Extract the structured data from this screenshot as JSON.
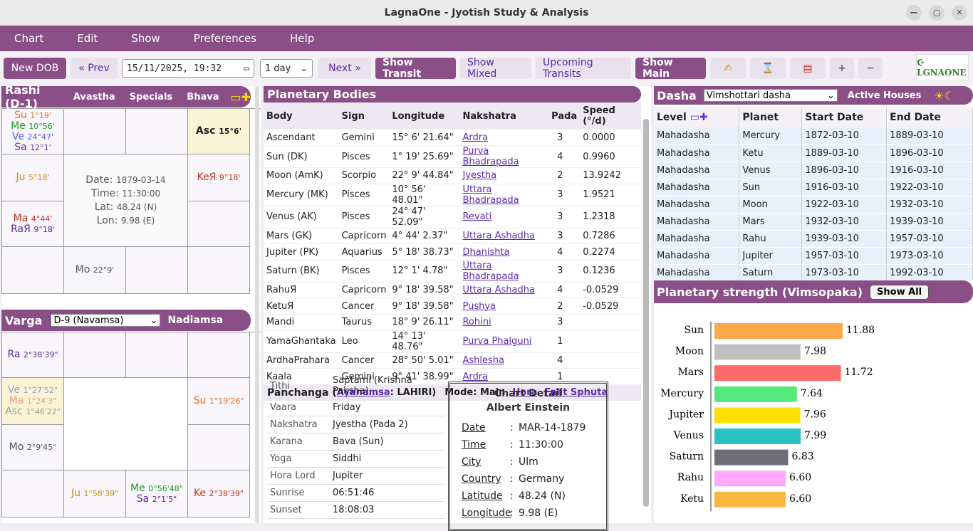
{
  "window": {
    "title": "LagnaOne - Jyotish Study & Analysis"
  },
  "menu": [
    "Chart",
    "Edit",
    "Show",
    "Preferences",
    "Help"
  ],
  "toolbar": {
    "new_dob": "New DOB",
    "prev": "« Prev",
    "datetime": "15/11/2025, 19:32",
    "step": "1 day",
    "next": "Next »",
    "show_transit": "Show Transit",
    "show_mixed": "Show Mixed",
    "upcoming": "Upcoming Transits",
    "show_main": "Show Main",
    "plus": "+",
    "minus": "−"
  },
  "icons": [
    "pen-icon",
    "hourglass-icon",
    "books-icon",
    "plus-icon",
    "minus-icon",
    "calendar-icon",
    "sun-moon-icon"
  ],
  "rashi": {
    "title": "Rashi (D-1)",
    "tabs": [
      "Avastha",
      "Specials",
      "Bhava"
    ],
    "center": {
      "date_label": "Date:",
      "date": "1879-03-14",
      "time_label": "Time:",
      "time": "11:30:00",
      "lat_label": "Lat:",
      "lat": "48.24 (N)",
      "lon_label": "Lon:",
      "lon": "9.98 (E)"
    },
    "cells": [
      {
        "r": 1,
        "c": 1,
        "items": [
          {
            "p": "Su",
            "d": "1°19'",
            "col": "#e07020"
          },
          {
            "p": "Me",
            "d": "10°56'",
            "col": "#1a9a1a"
          },
          {
            "p": "Ve",
            "d": "24°47'",
            "col": "#5a5ad8"
          },
          {
            "p": "Sa",
            "d": "12°1'",
            "col": "#6a2a8a"
          }
        ]
      },
      {
        "r": 1,
        "c": 2,
        "items": []
      },
      {
        "r": 1,
        "c": 3,
        "items": []
      },
      {
        "r": 1,
        "c": 4,
        "items": [
          {
            "p": "Asc",
            "d": "15°6'",
            "col": "#222"
          }
        ],
        "asc": true
      },
      {
        "r": 2,
        "c": 1,
        "items": [
          {
            "p": "Ju",
            "d": "5°18'",
            "col": "#d08a10"
          }
        ]
      },
      {
        "r": 2,
        "c": 4,
        "items": [
          {
            "p": "KeЯ",
            "d": "9°18'",
            "col": "#c03020"
          }
        ]
      },
      {
        "r": 3,
        "c": 1,
        "items": [
          {
            "p": "Ma",
            "d": "4°44'",
            "col": "#c03020"
          },
          {
            "p": "RaЯ",
            "d": "9°18'",
            "col": "#5a2a9a"
          }
        ]
      },
      {
        "r": 3,
        "c": 4,
        "items": []
      },
      {
        "r": 4,
        "c": 1,
        "items": []
      },
      {
        "r": 4,
        "c": 2,
        "items": [
          {
            "p": "Mo",
            "d": "22°9'",
            "col": "#555"
          }
        ]
      },
      {
        "r": 4,
        "c": 3,
        "items": []
      },
      {
        "r": 4,
        "c": 4,
        "items": []
      }
    ]
  },
  "varga": {
    "title": "Varga",
    "select": "D-9 (Navamsa)",
    "tab": "Nadiamsa",
    "cells": [
      {
        "r": 1,
        "c": 1,
        "items": [
          {
            "p": "Ra",
            "d": "2°38'39\"",
            "col": "#5a2a9a"
          }
        ]
      },
      {
        "r": 1,
        "c": 2,
        "items": []
      },
      {
        "r": 1,
        "c": 3,
        "items": []
      },
      {
        "r": 1,
        "c": 4,
        "items": []
      },
      {
        "r": 2,
        "c": 1,
        "items": [
          {
            "p": "Ve",
            "d": "1°27'52\"",
            "col": "#9a9ae0"
          },
          {
            "p": "Ma",
            "d": "1°24'3\"",
            "col": "#e8a080"
          },
          {
            "p": "Asc",
            "d": "1°46'22\"",
            "col": "#999"
          }
        ],
        "asc": true
      },
      {
        "r": 2,
        "c": 4,
        "items": [
          {
            "p": "Su",
            "d": "1°19'26\"",
            "col": "#e07020"
          }
        ]
      },
      {
        "r": 3,
        "c": 1,
        "items": [
          {
            "p": "Mo",
            "d": "2°9'45\"",
            "col": "#555"
          }
        ]
      },
      {
        "r": 3,
        "c": 4,
        "items": []
      },
      {
        "r": 4,
        "c": 1,
        "items": []
      },
      {
        "r": 4,
        "c": 2,
        "items": [
          {
            "p": "Ju",
            "d": "1°58'39\"",
            "col": "#d08a10"
          }
        ]
      },
      {
        "r": 4,
        "c": 3,
        "items": [
          {
            "p": "Me",
            "d": "0°56'48\"",
            "col": "#1a9a1a"
          },
          {
            "p": "Sa",
            "d": "2°1'5\"",
            "col": "#6a2a8a"
          }
        ]
      },
      {
        "r": 4,
        "c": 4,
        "items": [
          {
            "p": "Ke",
            "d": "2°38'39\"",
            "col": "#c03020"
          }
        ]
      }
    ]
  },
  "bodies": {
    "title": "Planetary Bodies",
    "headers": [
      "Body",
      "Sign",
      "Longitude",
      "Nakshatra",
      "Pada",
      "Speed (°/d)"
    ],
    "rows": [
      [
        "Ascendant",
        "Gemini",
        "15° 6' 21.64\"",
        "Ardra",
        "3",
        "0.0000"
      ],
      [
        "Sun (DK)",
        "Pisces",
        "1° 19' 25.69\"",
        "Purva Bhadrapada",
        "4",
        "0.9960"
      ],
      [
        "Moon (AmK)",
        "Scorpio",
        "22° 9' 44.84\"",
        "Jyestha",
        "2",
        "13.9242"
      ],
      [
        "Mercury (MK)",
        "Pisces",
        "10° 56' 48.01\"",
        "Uttara Bhadrapada",
        "3",
        "1.9521"
      ],
      [
        "Venus (AK)",
        "Pisces",
        "24° 47' 52.09\"",
        "Revati",
        "3",
        "1.2318"
      ],
      [
        "Mars (GK)",
        "Capricorn",
        "4° 44' 2.37\"",
        "Uttara Ashadha",
        "3",
        "0.7286"
      ],
      [
        "Jupiter (PK)",
        "Aquarius",
        "5° 18' 38.73\"",
        "Dhanishta",
        "4",
        "0.2274"
      ],
      [
        "Saturn (BK)",
        "Pisces",
        "12° 1' 4.78\"",
        "Uttara Bhadrapada",
        "3",
        "0.1236"
      ],
      [
        "RahuЯ",
        "Capricorn",
        "9° 18' 39.58\"",
        "Uttara Ashadha",
        "4",
        "-0.0529"
      ],
      [
        "KetuЯ",
        "Cancer",
        "9° 18' 39.58\"",
        "Pushya",
        "2",
        "-0.0529"
      ],
      [
        "Mandi",
        "Taurus",
        "18° 9' 26.11\"",
        "Rohini",
        "3",
        ""
      ],
      [
        "YamaGhantaka",
        "Leo",
        "14° 13' 48.76\"",
        "Purva Phalguni",
        "1",
        ""
      ],
      [
        "ArdhaPrahara",
        "Cancer",
        "28° 50' 5.01\"",
        "Ashlesha",
        "4",
        ""
      ],
      [
        "Kaala",
        "Gemini",
        "9° 41' 38.99\"",
        "Ardra",
        "1",
        ""
      ]
    ]
  },
  "panchanga": {
    "label": "Panchanga (",
    "ayanamsa": "Ayanamsa",
    "ayan_val": ": LAHIRI)",
    "mode": "Mode: Main",
    "hora": "Hora",
    "falit": "Falit Sphuta",
    "rows": [
      [
        "Tithi",
        "Saptami (Krishna Paksha)"
      ],
      [
        "Vaara",
        "Friday"
      ],
      [
        "Nakshatra",
        "Jyestha (Pada 2)"
      ],
      [
        "Karana",
        "Bava (Sun)"
      ],
      [
        "Yoga",
        "Siddhi"
      ],
      [
        "Hora Lord",
        "Jupiter"
      ],
      [
        "Sunrise",
        "06:51:46"
      ],
      [
        "Sunset",
        "18:08:03"
      ]
    ]
  },
  "chart_detail": {
    "title": "Chart Detail",
    "name": "Albert Einstein",
    "rows": [
      [
        "Date",
        "MAR-14-1879"
      ],
      [
        "Time",
        "11:30:00"
      ],
      [
        "City",
        "Ulm"
      ],
      [
        "Country",
        "Germany"
      ],
      [
        "Latitude",
        "48.24 (N)"
      ],
      [
        "Longitude",
        "9.98 (E)"
      ]
    ]
  },
  "dasha": {
    "title": "Dasha",
    "select": "Vimshottari dasha",
    "active": "Active Houses",
    "headers": [
      "Level",
      "Planet",
      "Start Date",
      "End Date"
    ],
    "rows": [
      [
        "Mahadasha",
        "Mercury",
        "1872-03-10",
        "1889-03-10"
      ],
      [
        "Mahadasha",
        "Ketu",
        "1889-03-10",
        "1896-03-10"
      ],
      [
        "Mahadasha",
        "Venus",
        "1896-03-10",
        "1916-03-10"
      ],
      [
        "Mahadasha",
        "Sun",
        "1916-03-10",
        "1922-03-10"
      ],
      [
        "Mahadasha",
        "Moon",
        "1922-03-10",
        "1932-03-10"
      ],
      [
        "Mahadasha",
        "Mars",
        "1932-03-10",
        "1939-03-10"
      ],
      [
        "Mahadasha",
        "Rahu",
        "1939-03-10",
        "1957-03-10"
      ],
      [
        "Mahadasha",
        "Jupiter",
        "1957-03-10",
        "1973-03-10"
      ],
      [
        "Mahadasha",
        "Saturn",
        "1973-03-10",
        "1992-03-10"
      ]
    ]
  },
  "strength": {
    "title": "Planetary strength (Vimsopaka)",
    "show_all": "Show All"
  },
  "chart_data": {
    "type": "bar",
    "orientation": "horizontal",
    "categories": [
      "Sun",
      "Moon",
      "Mars",
      "Mercury",
      "Jupiter",
      "Venus",
      "Saturn",
      "Rahu",
      "Ketu"
    ],
    "values": [
      11.88,
      7.98,
      11.72,
      7.64,
      7.96,
      7.99,
      6.83,
      6.6,
      6.6
    ],
    "labels": [
      "11.88",
      "7.98",
      "11.72",
      "7.64",
      "7.96",
      "7.99",
      "6.83",
      "6.60",
      "6.60"
    ],
    "colors": [
      "#f9a84a",
      "#c0c0c0",
      "#ff6b6b",
      "#55e87a",
      "#ffe000",
      "#28c4c4",
      "#6e6e7a",
      "#ffaaff",
      "#f9b840"
    ],
    "xlim": [
      0,
      20
    ]
  }
}
